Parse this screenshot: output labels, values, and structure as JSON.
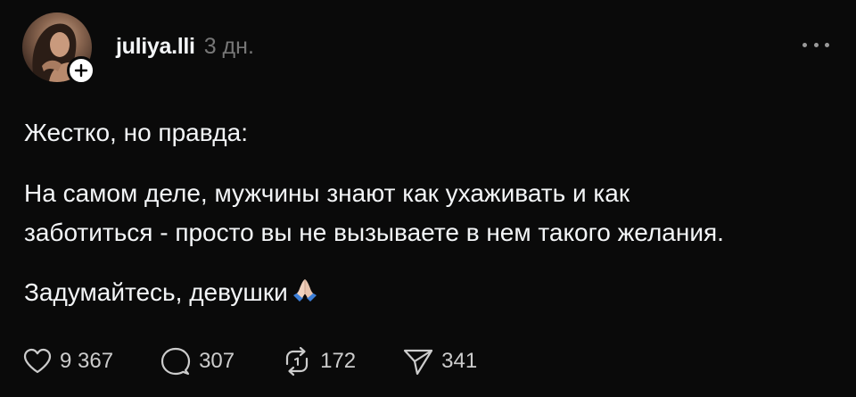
{
  "post": {
    "author": {
      "username": "juliya.lli",
      "timestamp": "3 дн."
    },
    "paragraphs": [
      "Жестко, но правда:",
      "На самом деле, мужчины знают как ухаживать и как",
      "заботиться - просто вы не вызываете в нем такого желания.",
      "Задумайтесь, девушки"
    ],
    "emoji": "🙏",
    "actions": {
      "likes": "9 367",
      "replies": "307",
      "reposts": "172",
      "shares": "341"
    }
  },
  "icons": {
    "follow": "plus-icon",
    "more": "more-horizontal-icon",
    "like": "heart-icon",
    "reply": "comment-icon",
    "repost": "repost-icon",
    "share": "send-icon"
  },
  "colors": {
    "background": "#0a0a0a",
    "text": "#f3f5f7",
    "muted": "#777777"
  }
}
